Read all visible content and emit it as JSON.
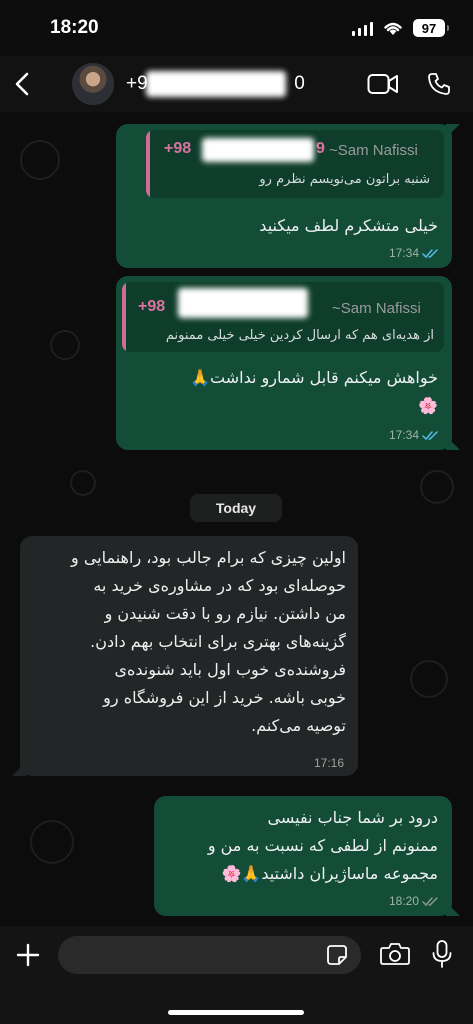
{
  "status_bar": {
    "time": "18:20",
    "battery": "97"
  },
  "header": {
    "contact_prefix": "+9",
    "contact_suffix": "0"
  },
  "messages": [
    {
      "direction": "outgoing",
      "quote": {
        "phone": "+98",
        "phone_suffix": "9",
        "name": "~Sam Nafissi",
        "text": "شنبه براتون می‌نویسم نظرم رو"
      },
      "text": "خیلی متشکرم لطف میکنید",
      "time": "17:34"
    },
    {
      "direction": "outgoing",
      "quote": {
        "phone": "+98",
        "name": "~Sam Nafissi",
        "text": "از هدیه‌ای هم که ارسال کردین خیلی خیلی ممنونم"
      },
      "text_line1": "خواهش میکنم قابل شمارو نداشت🙏",
      "text_line2": "🌸",
      "time": "17:34"
    },
    {
      "direction": "incoming",
      "lines": [
        "اولین چیزی که برام جالب بود، راهنمایی و",
        "حوصله‌ای بود که در مشاوره‌ی خرید به",
        "من داشتن. نیازم رو با دقت شنیدن و",
        "گزینه‌های بهتری برای انتخاب بهم دادن.",
        "فروشنده‌ی خوب اول باید شنونده‌ی",
        "خوبی باشه. خرید از این فروشگاه رو",
        "توصیه می‌کنم."
      ],
      "time": "17:16"
    },
    {
      "direction": "outgoing",
      "lines": [
        "درود بر شما جناب نفیسی",
        "ممنونم از لطفی که نسبت به من و",
        "مجموعه ماساژیران داشتید🙏🌸"
      ],
      "time": "18:20"
    }
  ],
  "date_separator": "Today",
  "icons": {
    "back": "chevron-left-icon",
    "video": "video-camera-icon",
    "call": "phone-icon",
    "attach": "plus-icon",
    "sticker": "sticker-icon",
    "camera": "camera-icon",
    "mic": "microphone-icon",
    "read": "double-check-icon"
  },
  "colors": {
    "outgoing_bubble": "#144d37",
    "incoming_bubble": "#232626",
    "quote_accent": "#d06c97",
    "read_tick": "#53bdeb"
  }
}
